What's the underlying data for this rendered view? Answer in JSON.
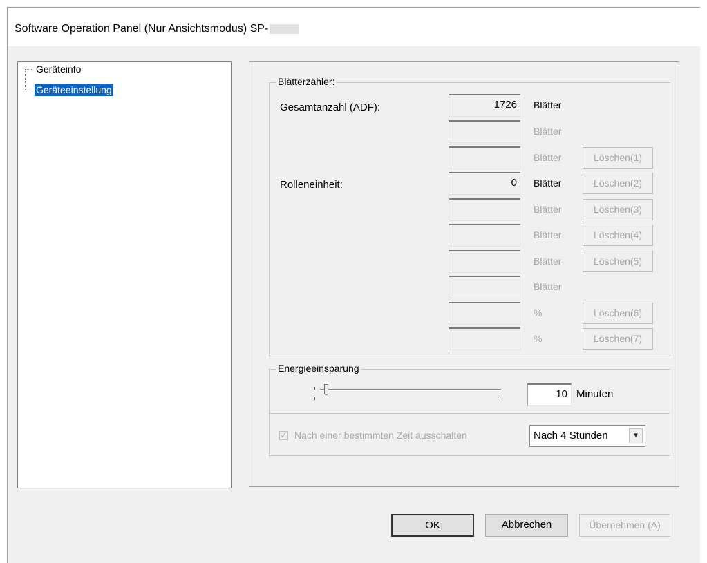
{
  "window": {
    "title": "Software Operation Panel (Nur Ansichtsmodus) SP-"
  },
  "tree": {
    "items": [
      {
        "label": "Geräteinfo",
        "selected": false
      },
      {
        "label": "Geräteeinstellung",
        "selected": true
      }
    ]
  },
  "sheet_counter": {
    "group_label": "Blätterzähler:",
    "total_label": "Gesamtanzahl (ADF):",
    "roller_label": "Rolleneinheit:",
    "rows": [
      {
        "value": "1726",
        "unit": "Blätter",
        "active": true,
        "button": ""
      },
      {
        "value": "",
        "unit": "Blätter",
        "active": false,
        "button": ""
      },
      {
        "value": "",
        "unit": "Blätter",
        "active": false,
        "button": "Löschen(1)"
      },
      {
        "value": "0",
        "unit": "Blätter",
        "active": true,
        "button": "Löschen(2)"
      },
      {
        "value": "",
        "unit": "Blätter",
        "active": false,
        "button": "Löschen(3)"
      },
      {
        "value": "",
        "unit": "Blätter",
        "active": false,
        "button": "Löschen(4)"
      },
      {
        "value": "",
        "unit": "Blätter",
        "active": false,
        "button": "Löschen(5)"
      },
      {
        "value": "",
        "unit": "Blätter",
        "active": false,
        "button": ""
      },
      {
        "value": "",
        "unit": "%",
        "active": false,
        "button": "Löschen(6)"
      },
      {
        "value": "",
        "unit": "%",
        "active": false,
        "button": "Löschen(7)"
      }
    ]
  },
  "power_saving": {
    "group_label": "Energieeinsparung",
    "minutes_value": "10",
    "minutes_unit": "Minuten",
    "checkbox_label": "Nach einer bestimmten Zeit ausschalten",
    "checkbox_checked": true,
    "select_value": "Nach 4 Stunden"
  },
  "buttons": {
    "ok": "OK",
    "cancel": "Abbrechen",
    "apply": "Übernehmen (A)"
  }
}
